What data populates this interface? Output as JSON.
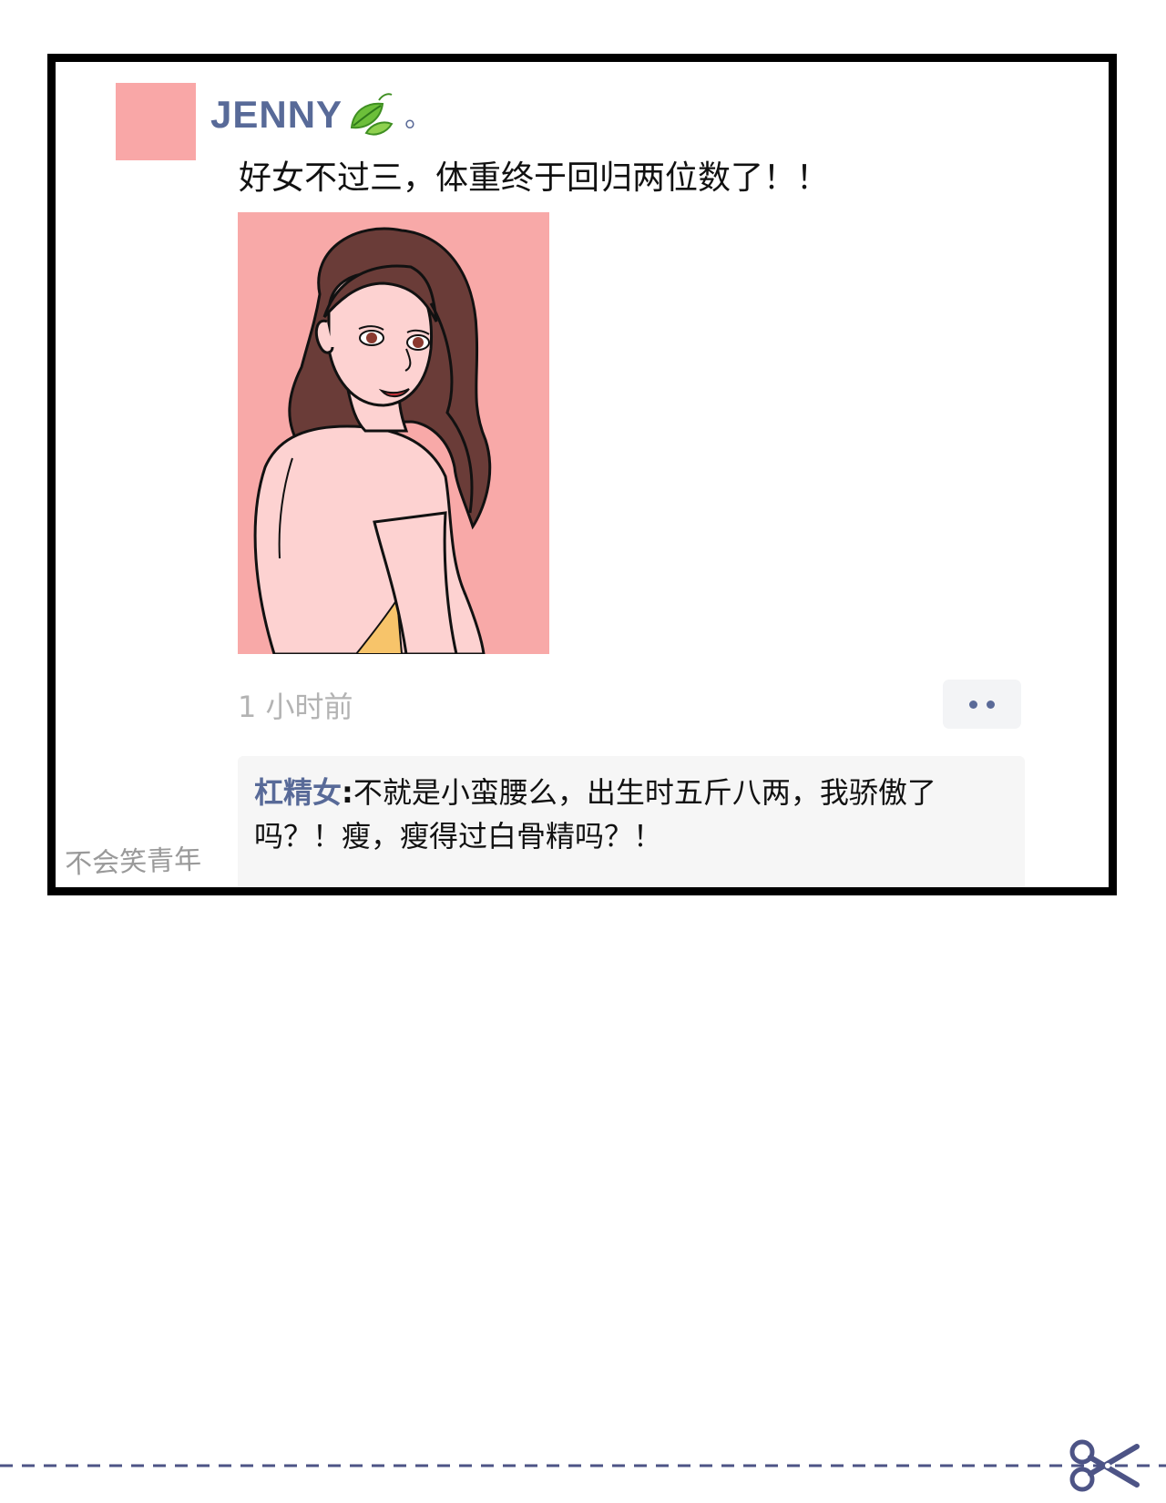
{
  "post": {
    "username": "JENNY",
    "username_suffix": "。",
    "text": "好女不过三，体重终于回归两位数了！！",
    "timestamp": "1 小时前",
    "more_icon": "more-dots-icon"
  },
  "comment": {
    "author": "杠精女",
    "separator": ":",
    "text": "不就是小蛮腰么，出生时五斤八两，我骄傲了吗？！瘦，瘦得过白骨精吗？！"
  },
  "watermark": "不会笑青年",
  "colors": {
    "username": "#586a98",
    "avatar": "#f9a7a7",
    "photo_bg": "#f8a9a8",
    "skin": "#fdd2d1",
    "hair": "#6a3c38",
    "comment_bg": "#f6f6f6",
    "button_bg": "#f3f4f6",
    "dots": "#5a6a98",
    "cut_line": "#4d5486"
  }
}
